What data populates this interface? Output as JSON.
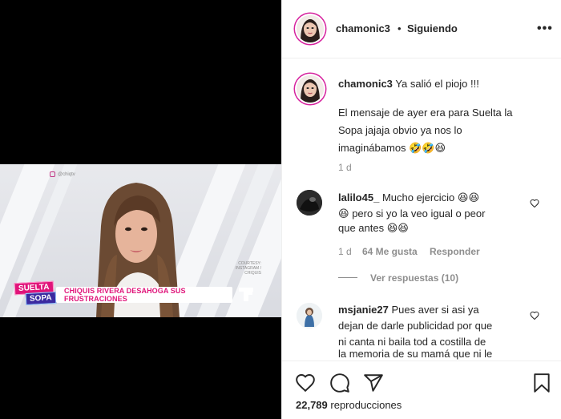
{
  "video": {
    "watermark": "@chiqtv",
    "banner": "CHIQUIS RIVERA DESAHOGA SUS FRUSTRACIONES",
    "logo_top": "SUELTA",
    "logo_bottom": "SOPA",
    "credit": "COURTESY: INSTAGRAM / CHIQUIS"
  },
  "header": {
    "username": "chamonic3",
    "separator": "•",
    "follow_status": "Siguiendo",
    "more": "•••"
  },
  "caption": {
    "username": "chamonic3",
    "line1": "Ya salió el piojo !!!",
    "line2": "El mensaje de ayer era para Suelta la",
    "line3": "Sopa jajaja obvio ya nos lo",
    "line4": "imaginábamos",
    "emojis": "🤣🤣😆",
    "time": "1 d"
  },
  "comments": [
    {
      "username": "lalilo45_",
      "line1": "Mucho ejercicio",
      "emoji1": "😆😆",
      "line2_emoji": "😆",
      "line2": "pero si yo la veo igual o peor",
      "line3": "que antes",
      "emoji3": "😆😆",
      "time": "1 d",
      "likes": "64 Me gusta",
      "reply": "Responder",
      "view_replies": "Ver respuestas (10)"
    },
    {
      "username": "msjanie27",
      "line1": "Pues aver si asi ya",
      "line2": "dejan de darle publicidad por que",
      "line3": "ni canta ni baila tod a costilla de",
      "line4": "la memoria de su mamá que ni le"
    }
  ],
  "footer": {
    "views_count": "22,789",
    "views_label": "reproducciones"
  },
  "colors": {
    "story_ring": "#d6249f",
    "secondary_text": "#8e8e8e",
    "banner_pink": "#e0147a"
  }
}
